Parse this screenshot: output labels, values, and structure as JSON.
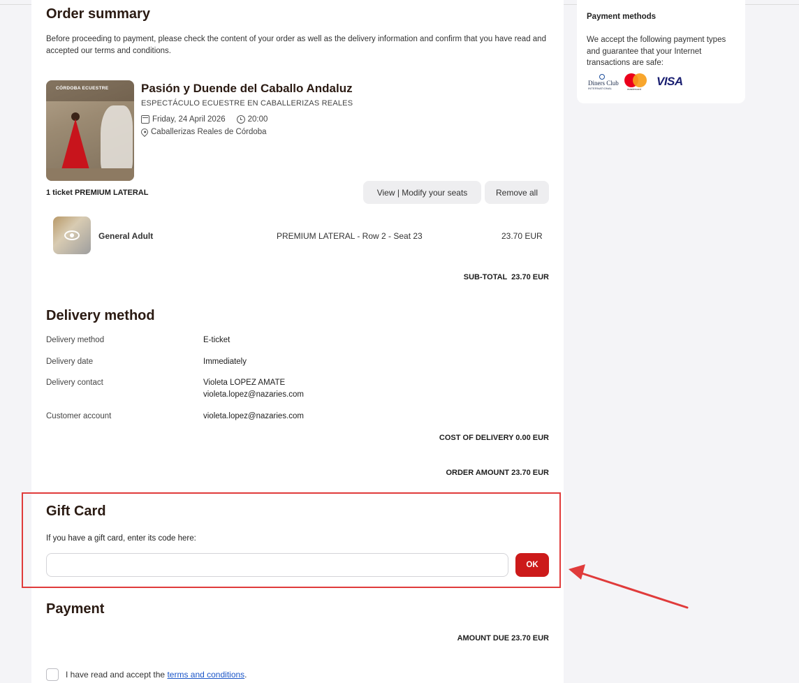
{
  "order_summary": {
    "title": "Order summary",
    "intro": "Before proceeding to payment, please check the content of your order as well as the delivery information and confirm that you have read and accepted our terms and conditions."
  },
  "event": {
    "title": "Pasión y Duende del Caballo Andaluz",
    "subtitle": "ESPECTÁCULO ECUESTRE EN CABALLERIZAS REALES",
    "date": "Friday, 24 April 2026",
    "time": "20:00",
    "venue": "Caballerizas Reales de Córdoba",
    "image_logo_text": "CÓRDOBA ECUESTRE"
  },
  "tickets": {
    "label": "1 ticket PREMIUM LATERAL",
    "view_modify_label": "View | Modify your seats",
    "remove_all_label": "Remove all",
    "items": [
      {
        "type": "General Adult",
        "seat": "PREMIUM LATERAL - Row 2 - Seat 23",
        "price": "23.70 EUR"
      }
    ],
    "subtotal": "SUB-TOTAL  23.70 EUR"
  },
  "delivery": {
    "title": "Delivery method",
    "rows": [
      {
        "label": "Delivery method",
        "value": "E-ticket"
      },
      {
        "label": "Delivery date",
        "value": "Immediately"
      },
      {
        "label": "Delivery contact",
        "value": "Violeta LOPEZ AMATE",
        "value2": "violeta.lopez@nazaries.com"
      },
      {
        "label": "Customer account",
        "value": "violeta.lopez@nazaries.com"
      }
    ],
    "cost": "COST OF DELIVERY 0.00 EUR",
    "order_amount": "ORDER AMOUNT 23.70 EUR"
  },
  "gift_card": {
    "title": "Gift Card",
    "description": "If you have a gift card, enter its code here:",
    "input_value": "",
    "ok_label": "OK"
  },
  "payment": {
    "title": "Payment",
    "amount_due": "AMOUNT DUE 23.70 EUR",
    "terms_prefix": "I have read and accept the ",
    "terms_link": "terms and conditions",
    "terms_suffix": "."
  },
  "payment_methods": {
    "title": "Payment methods",
    "text": "We accept the following payment types and guarantee that your Internet transactions are safe:",
    "diners_text": "Diners Club",
    "diners_sub": "INTERNATIONAL",
    "mastercard_text": "mastercard",
    "visa_text": "VISA"
  },
  "colors": {
    "accent_red": "#cc1a1a",
    "highlight_frame": "#e03b3b",
    "link_blue": "#1a55c8",
    "heading_brown": "#2a1a12"
  }
}
